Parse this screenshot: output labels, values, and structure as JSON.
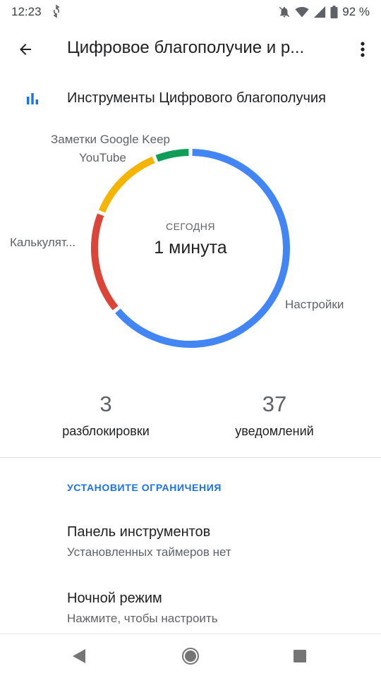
{
  "status_bar": {
    "time": "12:23",
    "battery": "92 %",
    "icons": [
      "sync-icon",
      "notifications-off-icon",
      "wifi-icon",
      "signal-icon",
      "battery-icon"
    ]
  },
  "app_bar": {
    "title": "Цифровое благополучие и р...",
    "back_icon": "arrow-back-icon",
    "more_icon": "more-vert-icon"
  },
  "tools_row": {
    "icon": "bar-chart-icon",
    "label": "Инструменты Цифрового благополучия"
  },
  "chart_data": {
    "type": "pie",
    "center_caption": "СЕГОДНЯ",
    "center_value": "1 минута",
    "slices": [
      {
        "label": "Настройки",
        "value": 64,
        "color": "#4285f4"
      },
      {
        "label": "Калькулят...",
        "value": 17,
        "color": "#db4437"
      },
      {
        "label": "YouTube",
        "value": 13,
        "color": "#f4b400"
      },
      {
        "label": "Заметки Google Keep",
        "value": 6,
        "color": "#0f9d58"
      }
    ]
  },
  "stats": [
    {
      "value": "3",
      "label": "разблокировки"
    },
    {
      "value": "37",
      "label": "уведомлений"
    }
  ],
  "limits": {
    "header": "УСТАНОВИТЕ ОГРАНИЧЕНИЯ",
    "items": [
      {
        "title": "Панель инструментов",
        "subtitle": "Установленных таймеров нет"
      },
      {
        "title": "Ночной режим",
        "subtitle": "Нажмите, чтобы настроить"
      }
    ]
  },
  "nav_bar": {
    "icons": [
      "nav-back-icon",
      "nav-home-icon",
      "nav-recents-icon"
    ]
  },
  "colors": {
    "accent": "#1a73e8",
    "blue": "#4285f4",
    "red": "#db4437",
    "yellow": "#f4b400",
    "green": "#0f9d58"
  }
}
